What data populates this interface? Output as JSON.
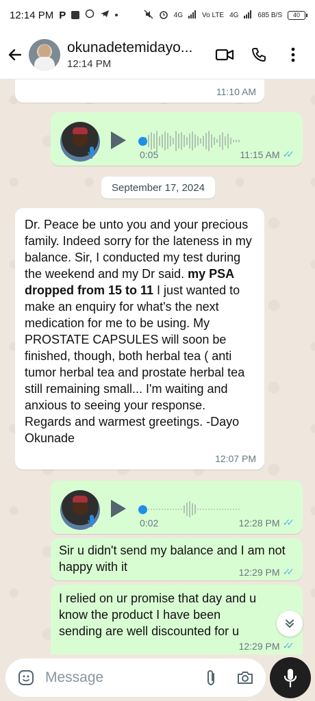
{
  "status_bar": {
    "time": "12:14 PM",
    "left_icons": [
      "p-icon",
      "square-icon",
      "whatsapp-icon",
      "telegram-icon",
      "dot-icon"
    ],
    "net1": "4G",
    "net2": "Vo LTE",
    "net3": "4G",
    "speed": "685 B/S",
    "battery": "40"
  },
  "header": {
    "contact_name": "okunadetemidayo...",
    "last_seen": "12:14 PM"
  },
  "messages": {
    "top_partial_time": "11:10 AM",
    "voice1": {
      "duration": "0:05",
      "time": "11:15 AM"
    },
    "date_divider": "September 17, 2024",
    "incoming": {
      "part1": "Dr. Peace be unto you and your precious family. Indeed sorry for the lateness in my balance. Sir, I conducted my test during the weekend and my Dr said. ",
      "bold": "my PSA dropped from 15 to 11",
      "part2": " I just wanted to make an enquiry for what's the next medication for me to be using. My PROSTATE CAPSULES will soon be finished, though, both herbal tea ( anti tumor herbal tea and prostate herbal tea still remaining small... I'm waiting and anxious to seeing your response. Regards and warmest greetings. -Dayo Okunade",
      "time": "12:07 PM"
    },
    "voice2": {
      "duration": "0:02",
      "time": "12:28 PM"
    },
    "out1": {
      "text": "Sir u didn't send my balance and I am not happy with it",
      "time": "12:29 PM"
    },
    "out2": {
      "text": "I relied on ur promise that day and u know the product I have been sending are well discounted for u",
      "time": "12:29 PM"
    }
  },
  "composer": {
    "placeholder": "Message"
  },
  "colors": {
    "outgoing_bubble": "#d9fdd3",
    "incoming_bubble": "#ffffff",
    "read_ticks": "#53bdeb",
    "chat_bg": "#efe7de"
  }
}
